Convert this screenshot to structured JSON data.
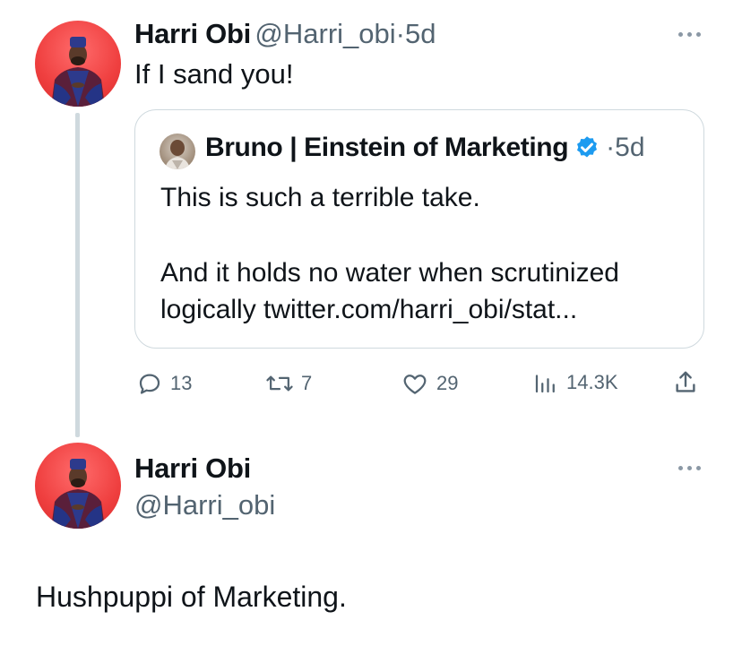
{
  "parent_tweet": {
    "author_name": "Harri Obi",
    "author_handle": "@Harri_obi",
    "separator": "·",
    "time": "5d",
    "text": "If I sand you!",
    "quoted": {
      "author_name": "Bruno | Einstein of Marketing",
      "separator": "·",
      "time": "5d",
      "line1": "This is such a terrible take.",
      "line2": "And it holds no water when scrutinized",
      "line3": "logically twitter.com/harri_obi/stat..."
    },
    "actions": {
      "replies": "13",
      "retweets": "7",
      "likes": "29",
      "views": "14.3K"
    }
  },
  "reply_tweet": {
    "author_name": "Harri Obi",
    "author_handle": "@Harri_obi",
    "text": "Hushpuppi of Marketing."
  },
  "colors": {
    "verified": "#1d9bf0",
    "muted": "#536471",
    "thread_line": "#cfd9de",
    "avatar_bg": "#ef3f3f"
  }
}
